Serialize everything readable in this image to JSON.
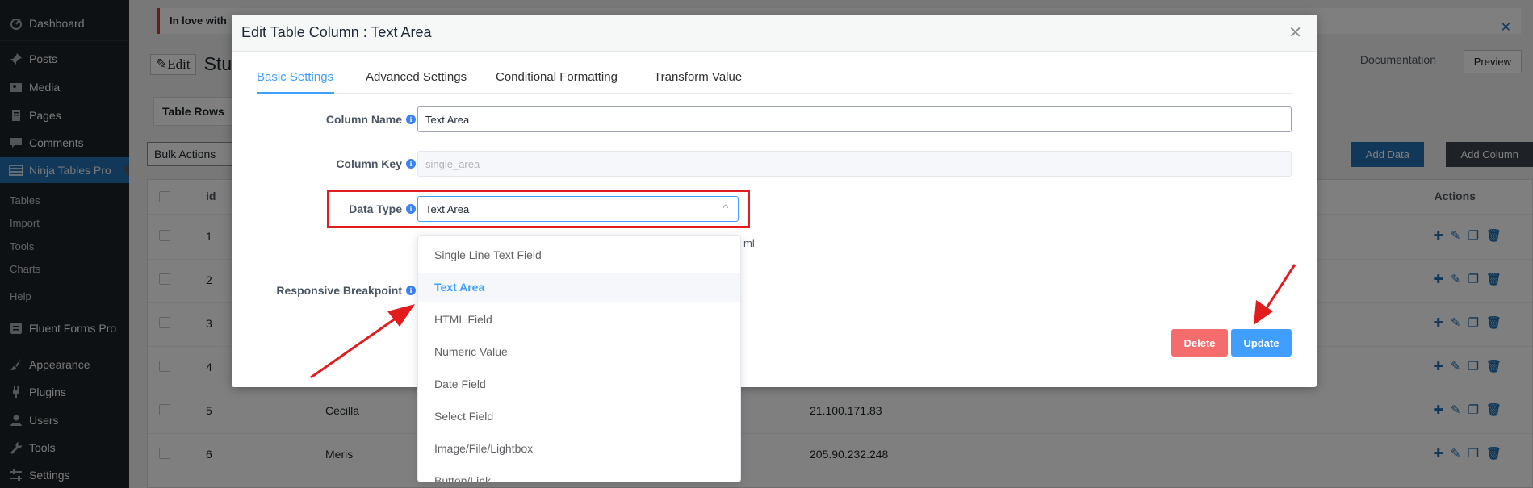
{
  "sidebar": {
    "items": [
      {
        "label": "Dashboard",
        "icon": "dashboard-icon"
      },
      {
        "label": "Posts",
        "icon": "pushpin-icon"
      },
      {
        "label": "Media",
        "icon": "media-icon"
      },
      {
        "label": "Pages",
        "icon": "pages-icon"
      },
      {
        "label": "Comments",
        "icon": "comment-icon"
      },
      {
        "label": "Ninja Tables Pro",
        "icon": "table-icon"
      },
      {
        "label": "Fluent Forms Pro",
        "icon": "form-icon"
      },
      {
        "label": "Appearance",
        "icon": "brush-icon"
      },
      {
        "label": "Plugins",
        "icon": "plugin-icon"
      },
      {
        "label": "Users",
        "icon": "user-icon"
      },
      {
        "label": "Tools",
        "icon": "wrench-icon"
      },
      {
        "label": "Settings",
        "icon": "settings-icon"
      }
    ],
    "submenu": [
      "Tables",
      "Import",
      "Tools",
      "Charts",
      "Help"
    ]
  },
  "page": {
    "notice": "In love with",
    "edit_chip": "Edit",
    "title": "Stud",
    "docs_link": "Documentation",
    "preview": "Preview",
    "bg_tab": "Table Rows",
    "bulk": "Bulk Actions",
    "add_data": "Add Data",
    "add_column": "Add Column",
    "th_id": "id",
    "th_actions": "Actions",
    "rows": [
      {
        "id": "1",
        "name": "",
        "ip": ""
      },
      {
        "id": "2",
        "name": "",
        "ip": ""
      },
      {
        "id": "3",
        "name": "",
        "ip": ""
      },
      {
        "id": "4",
        "name": "",
        "ip": ""
      },
      {
        "id": "5",
        "name": "Cecilla",
        "ip": "21.100.171.83"
      },
      {
        "id": "6",
        "name": "Meris",
        "ip": "205.90.232.248"
      }
    ]
  },
  "modal": {
    "title": "Edit Table Column : Text Area",
    "tabs": [
      "Basic Settings",
      "Advanced Settings",
      "Conditional Formatting",
      "Transform Value"
    ],
    "active_tab": "Basic Settings",
    "column_name_label": "Column Name",
    "column_name_value": "Text Area",
    "column_key_label": "Column Key",
    "column_key_placeholder": "single_area",
    "data_type_label": "Data Type",
    "data_type_value": "Text Area",
    "hint_tail": "ml",
    "responsive_label": "Responsive Breakpoint",
    "delete_label": "Delete",
    "update_label": "Update"
  },
  "dropdown": {
    "options": [
      "Single Line Text Field",
      "Text Area",
      "HTML Field",
      "Numeric Value",
      "Date Field",
      "Select Field",
      "Image/File/Lightbox",
      "Button/Link"
    ],
    "selected": "Text Area"
  },
  "colors": {
    "accent": "#409eff",
    "danger": "#f56c6c",
    "highlight": "#e11d1d",
    "wp_blue": "#2271b1"
  }
}
